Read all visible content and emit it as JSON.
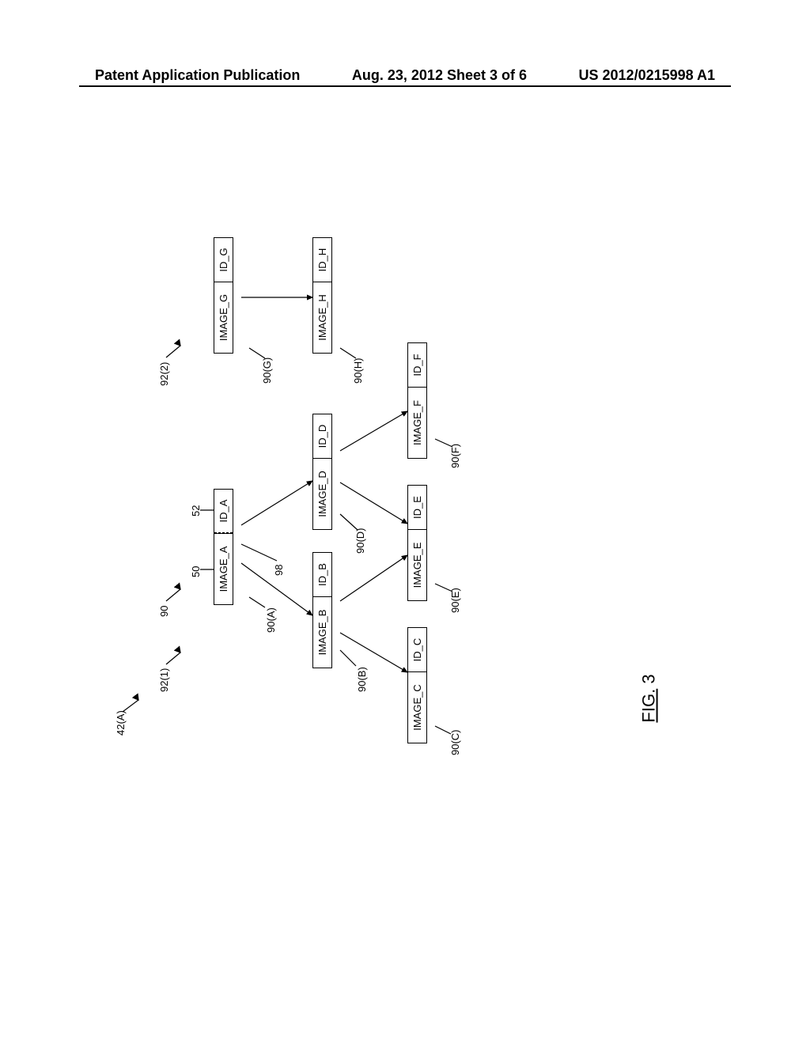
{
  "header": {
    "left": "Patent Application Publication",
    "center": "Aug. 23, 2012  Sheet 3 of 6",
    "right": "US 2012/0215998 A1"
  },
  "figure_label_prefix": "FIG.",
  "figure_label_number": " 3",
  "labels": {
    "l42a": "42(A)",
    "l92_1": "92(1)",
    "l90": "90",
    "l50": "50",
    "l52": "52",
    "l98": "98",
    "l90a": "90(A)",
    "l90b": "90(B)",
    "l90c": "90(C)",
    "l90d": "90(D)",
    "l90e": "90(E)",
    "l90f": "90(F)",
    "l92_2": "92(2)",
    "l90g": "90(G)",
    "l90h": "90(H)"
  },
  "nodes": {
    "A": {
      "image": "IMAGE_A",
      "id": "ID_A"
    },
    "B": {
      "image": "IMAGE_B",
      "id": "ID_B"
    },
    "C": {
      "image": "IMAGE_C",
      "id": "ID_C"
    },
    "D": {
      "image": "IMAGE_D",
      "id": "ID_D"
    },
    "E": {
      "image": "IMAGE_E",
      "id": "ID_E"
    },
    "F": {
      "image": "IMAGE_F",
      "id": "ID_F"
    },
    "G": {
      "image": "IMAGE_G",
      "id": "ID_G"
    },
    "H": {
      "image": "IMAGE_H",
      "id": "ID_H"
    }
  }
}
